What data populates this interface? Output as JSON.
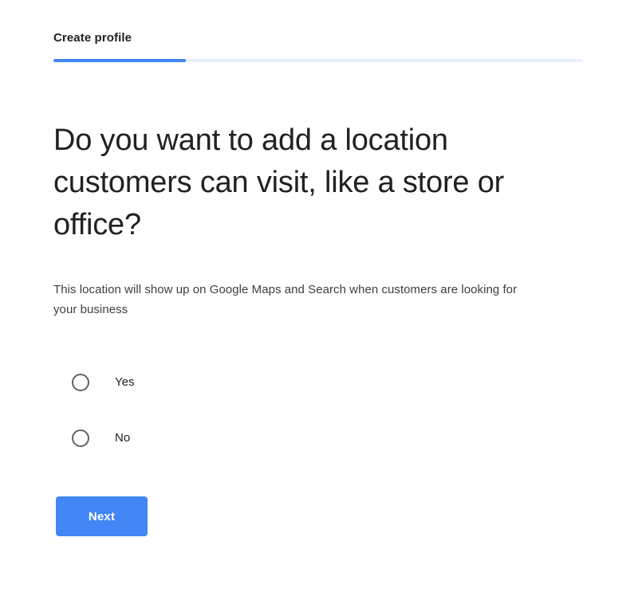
{
  "header": {
    "step_title": "Create profile"
  },
  "progress": {
    "percent": 25,
    "fill_color": "#4285f4",
    "track_color": "#e8eefb"
  },
  "main": {
    "headline": "Do you want to add a location customers can visit, like a store or office?",
    "subtext": "This location will show up on Google Maps and Search when customers are looking for your business",
    "radio_group": {
      "selected": null,
      "options": [
        {
          "value": "yes",
          "label": "Yes",
          "checked": false
        },
        {
          "value": "no",
          "label": "No",
          "checked": false
        }
      ]
    }
  },
  "actions": {
    "next_label": "Next",
    "next_color": "#4285f4"
  },
  "theme": {
    "background": "#ffffff",
    "text_primary": "#202124",
    "text_secondary": "#3c4043",
    "radio_border": "#5f6368",
    "accent": "#4285f4"
  }
}
